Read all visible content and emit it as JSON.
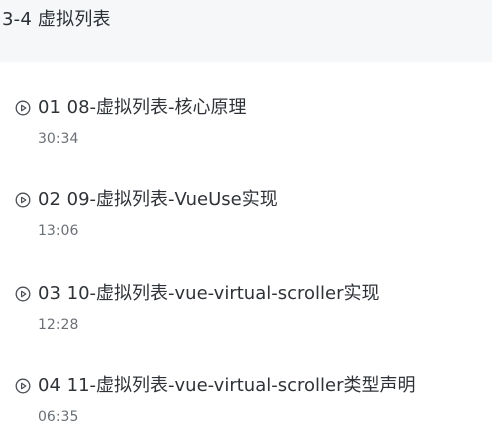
{
  "chapter": {
    "title": "3-4 虚拟列表"
  },
  "lessons": [
    {
      "index": "01",
      "title": "08-虚拟列表-核心原理",
      "duration": "30:34"
    },
    {
      "index": "02",
      "title": "09-虚拟列表-VueUse实现",
      "duration": "13:06"
    },
    {
      "index": "03",
      "title": "10-虚拟列表-vue-virtual-scroller实现",
      "duration": "12:28"
    },
    {
      "index": "04",
      "title": "11-虚拟列表-vue-virtual-scroller类型声明",
      "duration": "06:35"
    }
  ],
  "icons": {
    "lesson_icon": "play-circle-icon"
  },
  "colors": {
    "header_bg": "#f6f7f9",
    "text": "#2f3338",
    "muted": "#6b7076"
  }
}
